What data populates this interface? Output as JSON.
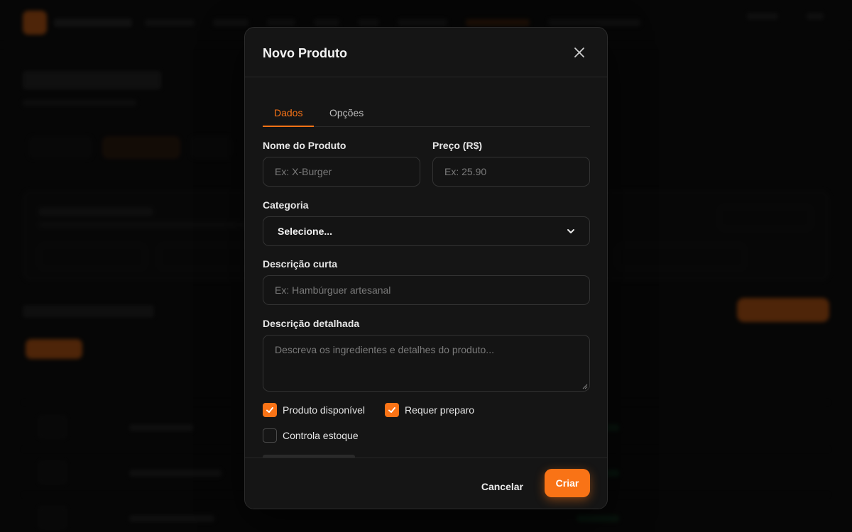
{
  "modal": {
    "title": "Novo Produto",
    "tabs": [
      {
        "label": "Dados",
        "active": true
      },
      {
        "label": "Opções",
        "active": false
      }
    ],
    "fields": {
      "name": {
        "label": "Nome do Produto",
        "value": "",
        "placeholder": "Ex: X-Burger"
      },
      "price": {
        "label": "Preço (R$)",
        "value": "",
        "placeholder": "Ex: 25.90"
      },
      "category": {
        "label": "Categoria",
        "selected": "Selecione..."
      },
      "short_description": {
        "label": "Descrição curta",
        "value": "",
        "placeholder": "Ex: Hambúrguer artesanal"
      },
      "long_description": {
        "label": "Descrição detalhada",
        "value": "",
        "placeholder": "Descreva os ingredientes e detalhes do produto..."
      }
    },
    "checkboxes": [
      {
        "label": "Produto disponível",
        "checked": true
      },
      {
        "label": "Requer preparo",
        "checked": true
      },
      {
        "label": "Controla estoque",
        "checked": false
      }
    ],
    "footer": {
      "cancel_label": "Cancelar",
      "create_label": "Criar"
    }
  },
  "colors": {
    "accent": "#f97316",
    "background": "#0b0b0b",
    "modal_bg": "#151515",
    "border": "#333333"
  },
  "icons": {
    "close": "close-icon",
    "select_caret": "chevron-down-icon",
    "checkbox_check": "check-icon"
  }
}
